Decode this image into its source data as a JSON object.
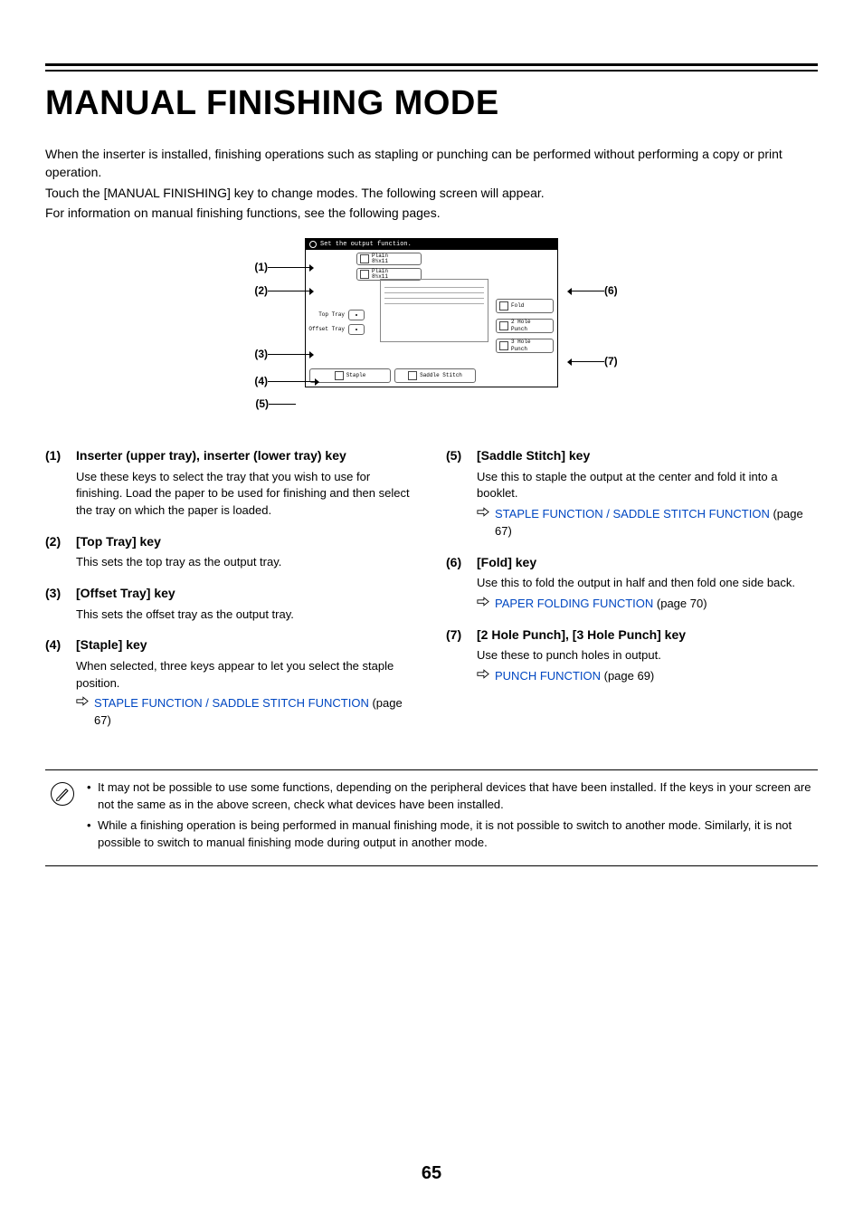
{
  "title": "MANUAL FINISHING MODE",
  "intro": {
    "p1": "When the inserter is installed, finishing operations such as stapling or punching can be performed without performing a copy or print operation.",
    "p2": "Touch the [MANUAL FINISHING] key to change modes. The following screen will appear.",
    "p3": "For information on manual finishing functions, see the following pages."
  },
  "diagram": {
    "banner": "Set the output function.",
    "paper_type": "Plain",
    "paper_size": "8½x11",
    "top_tray": "Top Tray",
    "offset_tray": "Offset Tray",
    "staple": "Staple",
    "saddle": "Saddle Stitch",
    "fold": "Fold",
    "punch2": "2 Hole Punch",
    "punch3": "3 Hole Punch",
    "callouts": {
      "c1": "(1)",
      "c2": "(2)",
      "c3": "(3)",
      "c4": "(4)",
      "c5": "(5)",
      "c6": "(6)",
      "c7": "(7)"
    }
  },
  "items_left": [
    {
      "num": "(1)",
      "title": "Inserter (upper tray), inserter (lower tray) key",
      "desc": "Use these keys to select the tray that you wish to use for finishing. Load the paper to be used for finishing and then select the tray on which the paper is loaded."
    },
    {
      "num": "(2)",
      "title": "[Top Tray] key",
      "desc": "This sets the top tray as the output tray."
    },
    {
      "num": "(3)",
      "title": "[Offset Tray] key",
      "desc": "This sets the offset tray as the output tray."
    },
    {
      "num": "(4)",
      "title": "[Staple] key",
      "desc": "When selected, three keys appear to let you select the staple position.",
      "link": {
        "text": "STAPLE FUNCTION / SADDLE STITCH FUNCTION",
        "page": "(page 67)"
      }
    }
  ],
  "items_right": [
    {
      "num": "(5)",
      "title": "[Saddle Stitch] key",
      "desc": "Use this to staple the output at the center and fold it into a booklet.",
      "link": {
        "text": "STAPLE FUNCTION / SADDLE STITCH FUNCTION",
        "page": "(page 67)"
      }
    },
    {
      "num": "(6)",
      "title": "[Fold] key",
      "desc": "Use this to fold the output in half and then fold one side back.",
      "link": {
        "text": "PAPER FOLDING FUNCTION",
        "page": " (page 70)"
      }
    },
    {
      "num": "(7)",
      "title": "[2 Hole Punch], [3 Hole Punch] key",
      "desc": "Use these to punch holes in output.",
      "link": {
        "text": "PUNCH FUNCTION",
        "page": " (page 69)"
      }
    }
  ],
  "notes": [
    "It may not be possible to use some functions, depending on the peripheral devices that have been installed. If the keys in your screen are not the same as in the above screen, check what devices have been installed.",
    "While a finishing operation is being performed in manual finishing mode, it is not possible to switch to another mode. Similarly, it is not possible to switch to manual finishing mode during output in another mode."
  ],
  "page_number": "65"
}
